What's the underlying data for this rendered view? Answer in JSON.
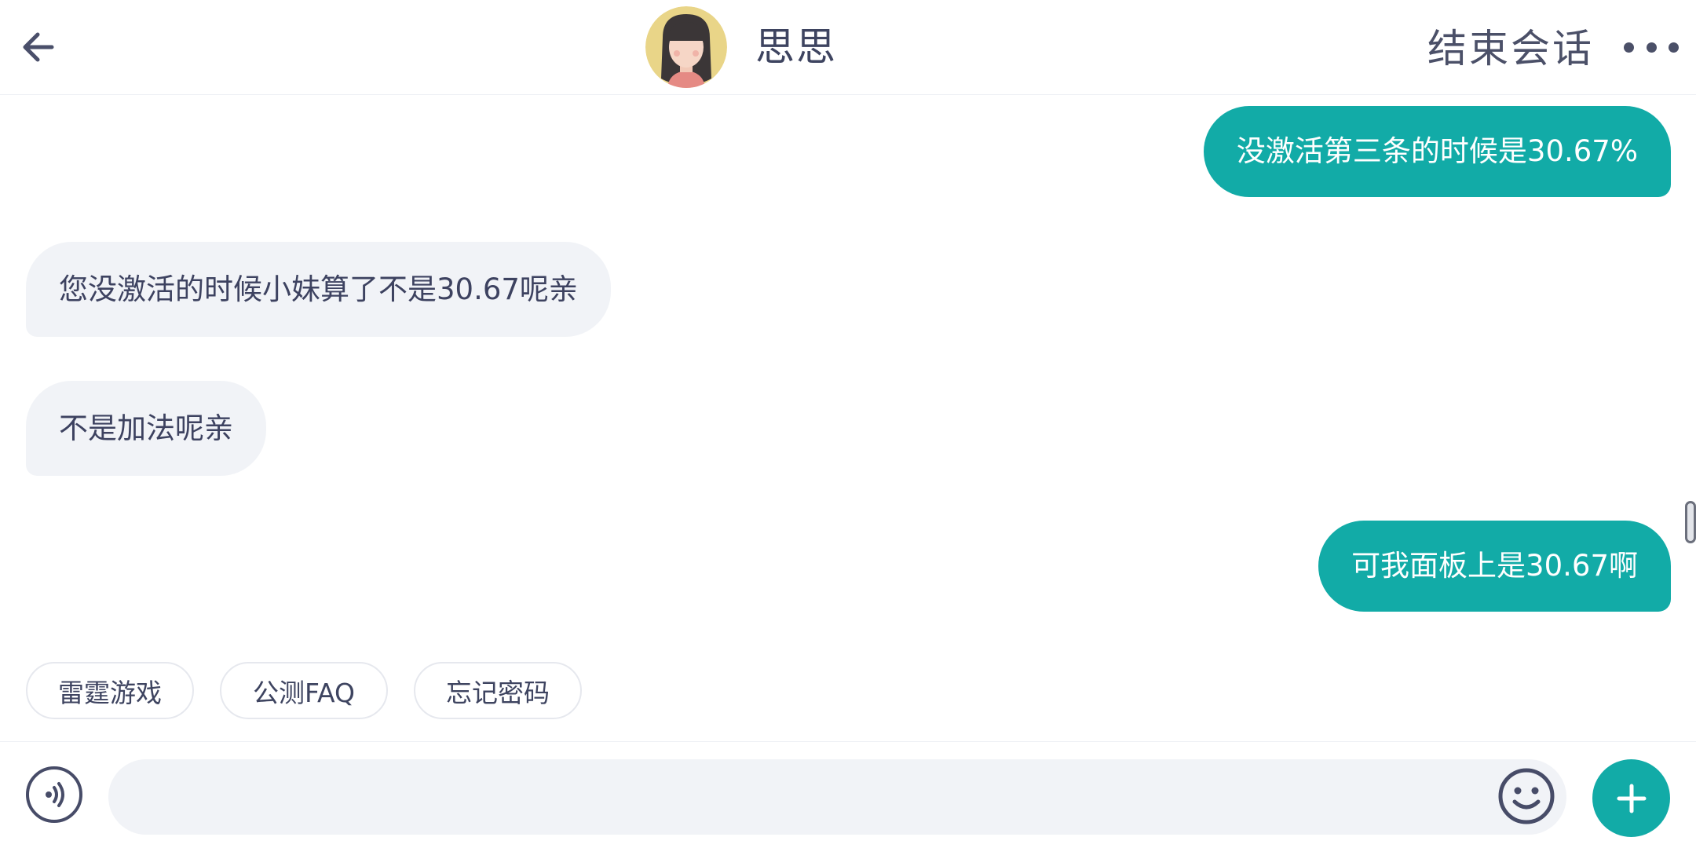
{
  "header": {
    "contact_name": "思思",
    "end_session_label": "结束会话"
  },
  "messages": [
    {
      "direction": "out",
      "text": "没激活第三条的时候是30.67%"
    },
    {
      "direction": "in",
      "text": "您没激活的时候小妹算了不是30.67呢亲"
    },
    {
      "direction": "in",
      "text": "不是加法呢亲"
    },
    {
      "direction": "out",
      "text": "可我面板上是30.67啊"
    }
  ],
  "quick_replies": [
    "雷霆游戏",
    "公测FAQ",
    "忘记密码"
  ],
  "input": {
    "value": "",
    "placeholder": ""
  },
  "icons": {
    "back": "arrow-left-icon",
    "more": "more-dots-icon",
    "voice": "voice-icon",
    "emoji": "emoji-icon",
    "plus": "plus-icon"
  },
  "colors": {
    "accent": "#12aba7",
    "incoming_bubble": "#f1f3f7",
    "text_primary": "#3e4460"
  }
}
